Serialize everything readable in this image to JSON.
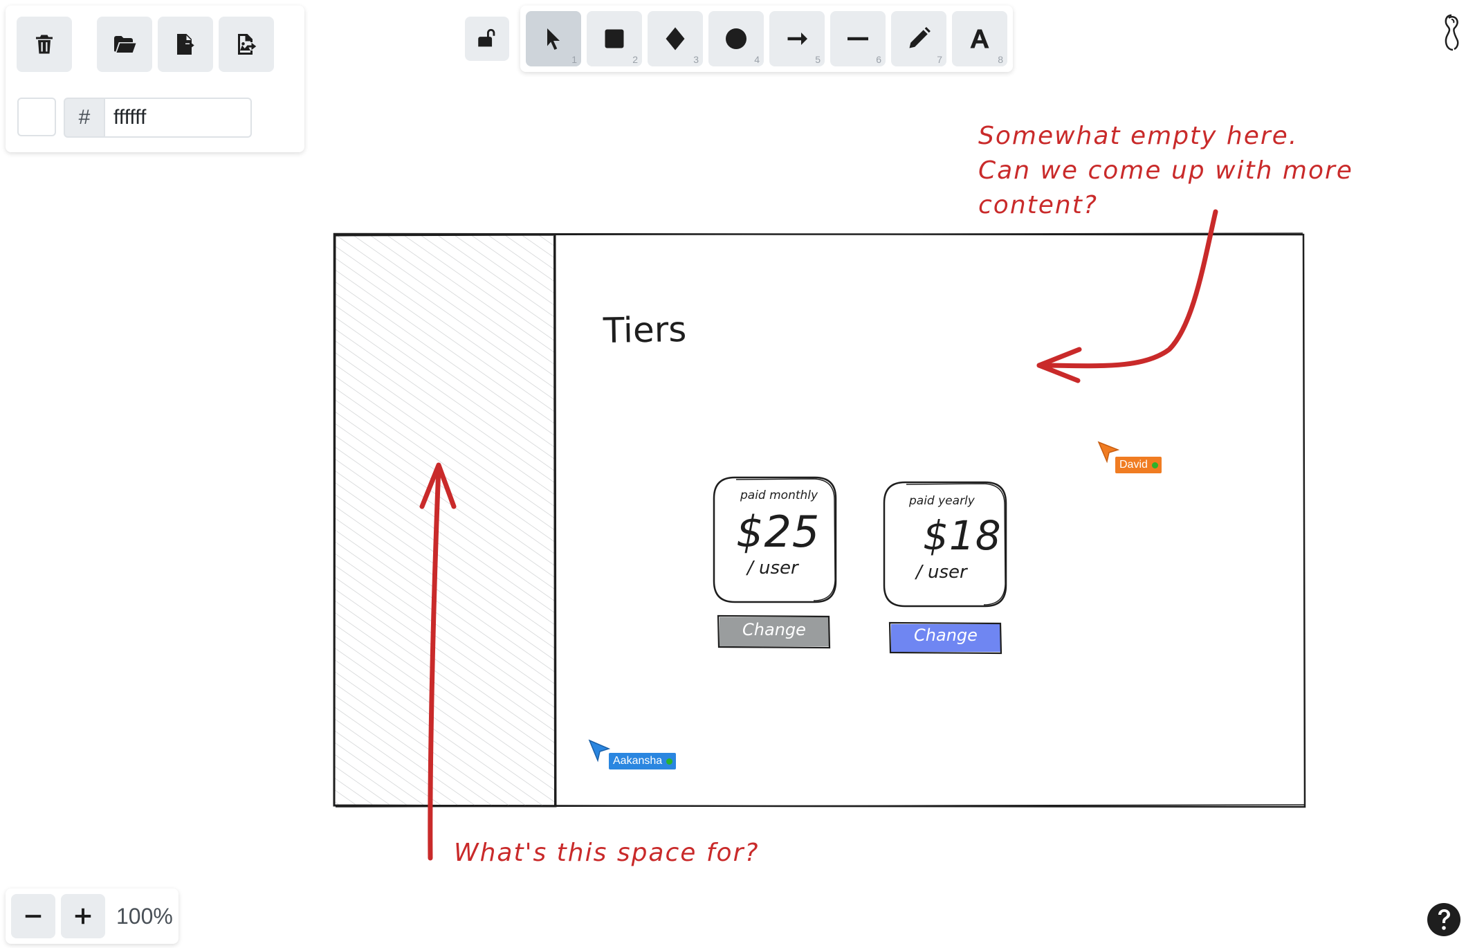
{
  "toolbar_left": {
    "delete_icon": "trash-icon",
    "open_icon": "folder-open-icon",
    "export_icon": "file-export-icon",
    "export_image_icon": "image-export-icon",
    "hash_symbol": "#",
    "bg_color_value": "ffffff",
    "bg_color_swatch": "#ffffff"
  },
  "lock_icon": "unlock-icon",
  "tools": [
    {
      "name": "selection",
      "icon": "pointer-icon",
      "shortcut": "1"
    },
    {
      "name": "rectangle",
      "icon": "square-icon",
      "shortcut": "2"
    },
    {
      "name": "diamond",
      "icon": "diamond-icon",
      "shortcut": "3"
    },
    {
      "name": "ellipse",
      "icon": "circle-icon",
      "shortcut": "4"
    },
    {
      "name": "arrow",
      "icon": "arrow-right-icon",
      "shortcut": "5"
    },
    {
      "name": "line",
      "icon": "line-icon",
      "shortcut": "6"
    },
    {
      "name": "draw",
      "icon": "pencil-icon",
      "shortcut": "7"
    },
    {
      "name": "text",
      "icon": "text-icon",
      "shortcut": "8"
    }
  ],
  "zoom": {
    "level": "100%",
    "minus_icon": "minus-icon",
    "plus_icon": "plus-icon"
  },
  "canvas": {
    "title": "Tiers",
    "cards": [
      {
        "label": "paid monthly",
        "price": "$25",
        "unit": "/ user",
        "button": "Change",
        "button_color": "#9a9d9e"
      },
      {
        "label": "paid yearly",
        "price": "$18",
        "unit": "/ user",
        "button": "Change",
        "button_color": "#6f86f2"
      }
    ],
    "notes": {
      "top_line1": "Somewhat empty here.",
      "top_line2": "Can we come up with more",
      "top_line3": "content?",
      "bottom": "What's this space for?"
    },
    "note_color": "#c92a2a"
  },
  "collaborators": [
    {
      "name": "David",
      "color": "#f07c22"
    },
    {
      "name": "Aakansha",
      "color": "#2a86e0"
    }
  ],
  "corner_icons": {
    "top_right": "github-icon",
    "bottom_right": "help-icon"
  }
}
